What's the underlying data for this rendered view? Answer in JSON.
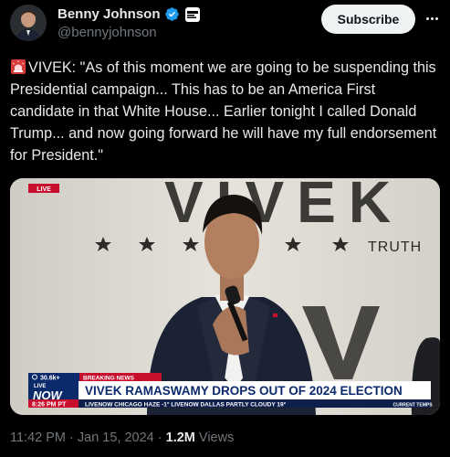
{
  "author": {
    "display_name": "Benny Johnson",
    "handle": "@bennyjohnson",
    "verified_icon": "verified-badge-icon",
    "affiliate_badge_icon": "news-affiliate-badge-icon"
  },
  "actions": {
    "subscribe_label": "Subscribe",
    "more_icon": "more-icon"
  },
  "tweet": {
    "emoji": "siren-emoji",
    "text": "VIVEK: \"As of this moment we are going to be suspending this Presidential campaign... This has to be an America First candidate in that White House... Earlier tonight I called Donald Trump... and now going forward he will have my full endorsement for President.\""
  },
  "media": {
    "live_tag": "LIVE",
    "backdrop_text": "VIVEK",
    "truth_text": "TRUTH",
    "viewers": "30.6k+",
    "breaking_label": "BREAKING NEWS",
    "network_top": "LIVE",
    "network_main": "NOW",
    "clock": "8:26 PM PT",
    "headline": "VIVEK RAMASWAMY DROPS OUT OF 2024 ELECTION",
    "ticker": "LIVENOW   CHICAGO   HAZE  -1°   LIVENOW   DALLAS   PARTLY CLOUDY  19°",
    "ticker_tag": "CURRENT TEMPS"
  },
  "meta": {
    "time": "11:42 PM",
    "date": "Jan 15, 2024",
    "views_count": "1.2M",
    "views_label": "Views"
  },
  "colors": {
    "background": "#000000",
    "text": "#e7e9ea",
    "secondary_text": "#71767b",
    "verified_blue": "#1d9bf0",
    "breaking_red": "#c8102e",
    "headline_navy": "#0b2a6b"
  }
}
